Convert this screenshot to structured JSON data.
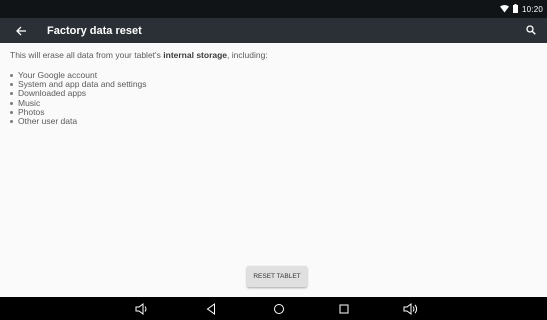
{
  "status_bar": {
    "time": "10:20",
    "icons": [
      "wifi-icon",
      "battery-icon"
    ]
  },
  "app_bar": {
    "title": "Factory data reset",
    "back_icon": "arrow-left-icon",
    "search_icon": "search-icon"
  },
  "content": {
    "intro_before": "This will erase all data from your tablet's ",
    "intro_bold": "internal storage",
    "intro_after": ", including:",
    "items": [
      "Your Google account",
      "System and app data and settings",
      "Downloaded apps",
      "Music",
      "Photos",
      "Other user data"
    ]
  },
  "action": {
    "reset_label": "RESET TABLET"
  },
  "nav_bar": {
    "buttons": [
      "volume-down-icon",
      "back-icon",
      "home-icon",
      "recents-icon",
      "volume-up-icon"
    ]
  },
  "colors": {
    "status_bar": "#101417",
    "app_bar": "#2a3035",
    "background": "#fafafa",
    "button": "#e0e0e0",
    "nav_bar": "#000000"
  }
}
